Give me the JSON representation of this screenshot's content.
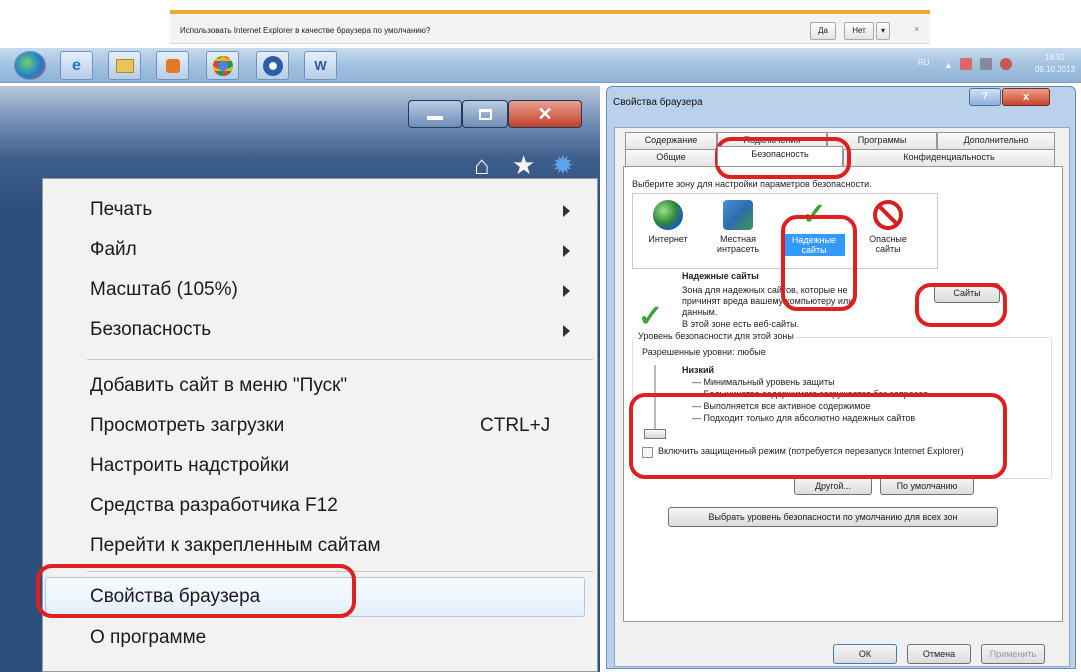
{
  "notification": {
    "text": "Использовать Internet Explorer в качестве браузера по умолчанию?",
    "yes": "Да",
    "no": "Нет",
    "dropdown": "▾",
    "close": "×"
  },
  "taskbar": {
    "apps": [
      "start-orb",
      "internet-explorer",
      "file-explorer",
      "media-player",
      "chrome",
      "thunderbird",
      "word"
    ],
    "tray_lang": "RU",
    "time": "14:52",
    "date": "09.10.2013"
  },
  "ie_menu": {
    "items": [
      {
        "label": "Печать",
        "submenu": true
      },
      {
        "label": "Файл",
        "submenu": true
      },
      {
        "label": "Масштаб (105%)",
        "submenu": true
      },
      {
        "label": "Безопасность",
        "submenu": true
      },
      {
        "label": "Добавить сайт в меню \"Пуск\""
      },
      {
        "label": "Просмотреть загрузки",
        "shortcut": "CTRL+J"
      },
      {
        "label": "Настроить надстройки"
      },
      {
        "label": "Средства разработчика F12"
      },
      {
        "label": "Перейти к закрепленным сайтам"
      },
      {
        "label": "Свойства браузера"
      },
      {
        "label": "О программе"
      }
    ]
  },
  "dialog": {
    "title": "Свойства браузера",
    "help": "?",
    "close": "x",
    "tabs_row1": [
      "Содержание",
      "Подключения",
      "Программы",
      "Дополнительно"
    ],
    "tabs_row2": [
      "Общие",
      "Безопасность",
      "Конфиденциальность"
    ],
    "zone_prompt": "Выберите зону для настройки параметров безопасности.",
    "zones": [
      {
        "label": "Интернет",
        "icon": "globe-icon"
      },
      {
        "label": "Местная интрасеть",
        "icon": "intranet-icon"
      },
      {
        "label": "Надежные сайты",
        "icon": "check-icon"
      },
      {
        "label": "Опасные сайты",
        "icon": "forbidden-icon"
      }
    ],
    "zone_title": "Надежные сайты",
    "zone_desc": "Зона для надежных сайтов, которые не причинят вреда вашему компьютеру или данным.",
    "zone_note": "В этой зоне есть веб-сайты.",
    "sites_button": "Сайты",
    "level_group": "Уровень безопасности для этой зоны",
    "allowed_levels": "Разрешенные уровни: любые",
    "level_name": "Низкий",
    "level_lines": [
      "— Минимальный уровень защиты",
      "— Большинство содержимого загружается без запросов",
      "— Выполняется все активное содержимое",
      "— Подходит только для абсолютно надежных сайтов"
    ],
    "protected_mode": "Включить защищенный режим (потребуется перезапуск Internet Explorer)",
    "custom_button": "Другой...",
    "default_button": "По умолчанию",
    "reset_all_button": "Выбрать уровень безопасности по умолчанию для всех зон",
    "ok": "ОК",
    "cancel": "Отмена",
    "apply": "Применить"
  }
}
